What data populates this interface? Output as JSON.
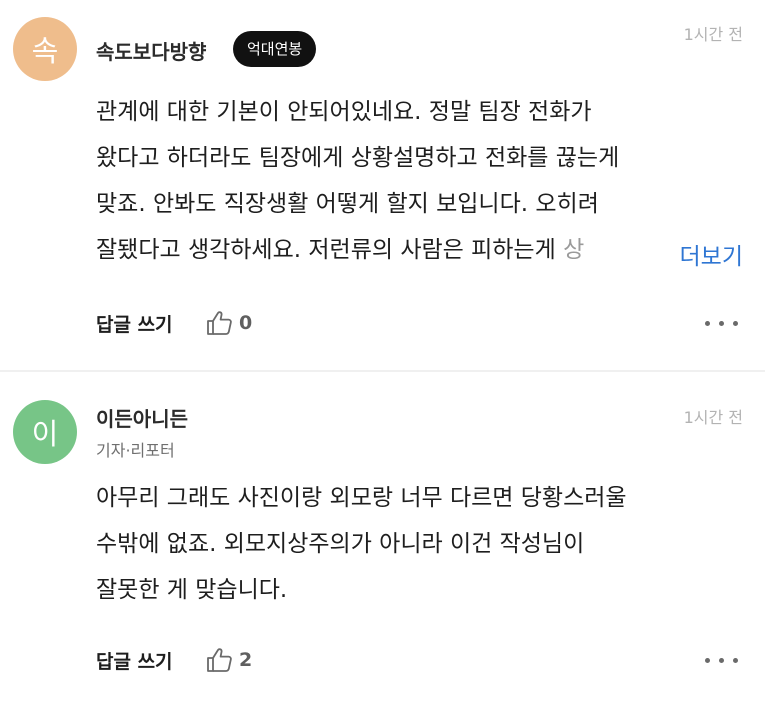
{
  "comments": [
    {
      "avatar_text": "속",
      "avatar_color": "#efbd8c",
      "nickname": "속도보다방향",
      "badge": "억대연봉",
      "time": "1시간 전",
      "lines": [
        "관계에 대한 기본이 안되어있네요. 정말 팀장 전화가",
        "왔다고 하더라도 팀장에게 상황설명하고 전화를 끊는게",
        "맞죠. 안봐도 직장생활 어떻게 할지 보입니다. 오히려",
        "잘됐다고 생각하세요. 저런류의 사람은 피하는게",
        "상"
      ],
      "more_label": "더보기",
      "reply_label": "답글 쓰기",
      "like_count": "0",
      "menu_icon": "more-horizontal-icon"
    },
    {
      "avatar_text": "이",
      "avatar_color": "#77c587",
      "nickname": "이든아니든",
      "role": "기자·리포터",
      "time": "1시간 전",
      "lines": [
        "아무리 그래도 사진이랑 외모랑 너무 다르면 당황스러울",
        "수밖에 없죠. 외모지상주의가 아니라 이건 작성님이",
        "잘못한 게 맞습니다."
      ],
      "reply_label": "답글 쓰기",
      "like_count": "2",
      "menu_icon": "more-horizontal-icon"
    }
  ],
  "colors": {
    "link": "#2f76d3",
    "time": "#b3b3b3",
    "badge_bg": "#111111"
  }
}
